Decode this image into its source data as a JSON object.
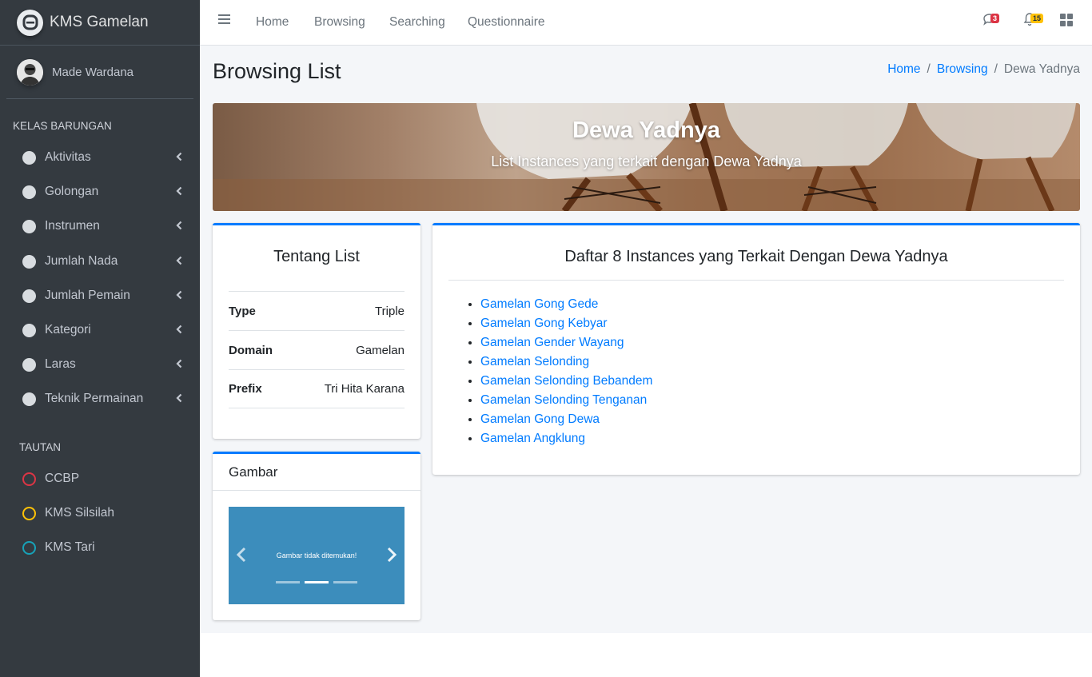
{
  "app": {
    "brand": "KMS Gamelan"
  },
  "user": {
    "name": "Made Wardana"
  },
  "sidebar": {
    "section1_header": "KELAS BARUNGAN",
    "items": [
      {
        "label": "Aktivitas"
      },
      {
        "label": "Golongan"
      },
      {
        "label": "Instrumen"
      },
      {
        "label": "Jumlah Nada"
      },
      {
        "label": "Jumlah Pemain"
      },
      {
        "label": "Kategori"
      },
      {
        "label": "Laras"
      },
      {
        "label": "Teknik Permainan"
      }
    ],
    "section2_header": "TAUTAN",
    "links": [
      {
        "label": "CCBP",
        "color": "#dc3545"
      },
      {
        "label": "KMS Silsilah",
        "color": "#ffc107"
      },
      {
        "label": "KMS Tari",
        "color": "#17a2b8"
      }
    ]
  },
  "topbar": {
    "links": [
      "Home",
      "Browsing",
      "Searching",
      "Questionnaire"
    ],
    "messages_badge": "3",
    "notifications_badge": "15"
  },
  "page": {
    "title": "Browsing List",
    "breadcrumb": [
      "Home",
      "Browsing",
      "Dewa Yadnya"
    ],
    "separator": "/"
  },
  "hero": {
    "title": "Dewa Yadnya",
    "subtitle": "List Instances yang terkait dengan Dewa Yadnya"
  },
  "about": {
    "title": "Tentang List",
    "rows": [
      {
        "key": "Type",
        "value": "Triple"
      },
      {
        "key": "Domain",
        "value": "Gamelan"
      },
      {
        "key": "Prefix",
        "value": "Tri Hita Karana"
      }
    ]
  },
  "gambar": {
    "title": "Gambar",
    "empty_text": "Gambar tidak ditemukan!"
  },
  "instances": {
    "title": "Daftar 8 Instances yang Terkait Dengan Dewa Yadnya",
    "items": [
      "Gamelan Gong Gede",
      "Gamelan Gong Kebyar",
      "Gamelan Gender Wayang",
      "Gamelan Selonding",
      "Gamelan Selonding Bebandem",
      "Gamelan Selonding Tenganan",
      "Gamelan Gong Dewa",
      "Gamelan Angklung"
    ]
  },
  "colors": {
    "accent": "#007bff",
    "sidebar_bg": "#343a40",
    "content_bg": "#f4f6f9",
    "carousel_bg": "#3c8dbc"
  }
}
